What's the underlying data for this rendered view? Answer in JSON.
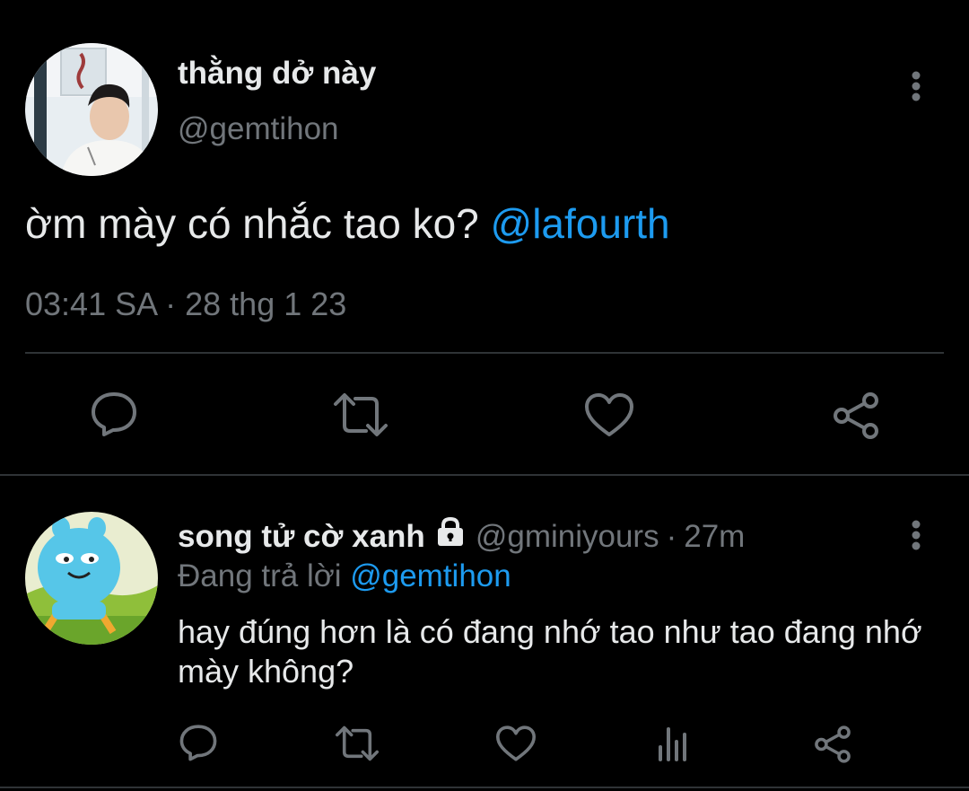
{
  "main_tweet": {
    "display_name": "thằng dở này",
    "handle": "@gemtihon",
    "text": "ờm mày có nhắc tao ko?",
    "mention": "@lafourth",
    "timestamp": "03:41 SA · 28 thg 1 23",
    "actions": [
      "reply-icon",
      "retweet-icon",
      "like-icon",
      "share-icon"
    ]
  },
  "reply_tweet": {
    "display_name": "song tử cờ xanh",
    "handle": "@gminiyours",
    "time_ago": "27m",
    "separator": "·",
    "replying_to_label": "Đang trả lời",
    "replying_to_handle": "@gemtihon",
    "text": "hay đúng hơn là có đang nhớ tao như tao đang nhớ mày không?",
    "actions": [
      "reply-icon",
      "retweet-icon",
      "like-icon",
      "analytics-icon",
      "share-icon"
    ]
  },
  "colors": {
    "background": "#000000",
    "text_primary": "#e7e9ea",
    "text_secondary": "#71767b",
    "accent": "#1d9bf0",
    "divider": "#2f3336"
  }
}
